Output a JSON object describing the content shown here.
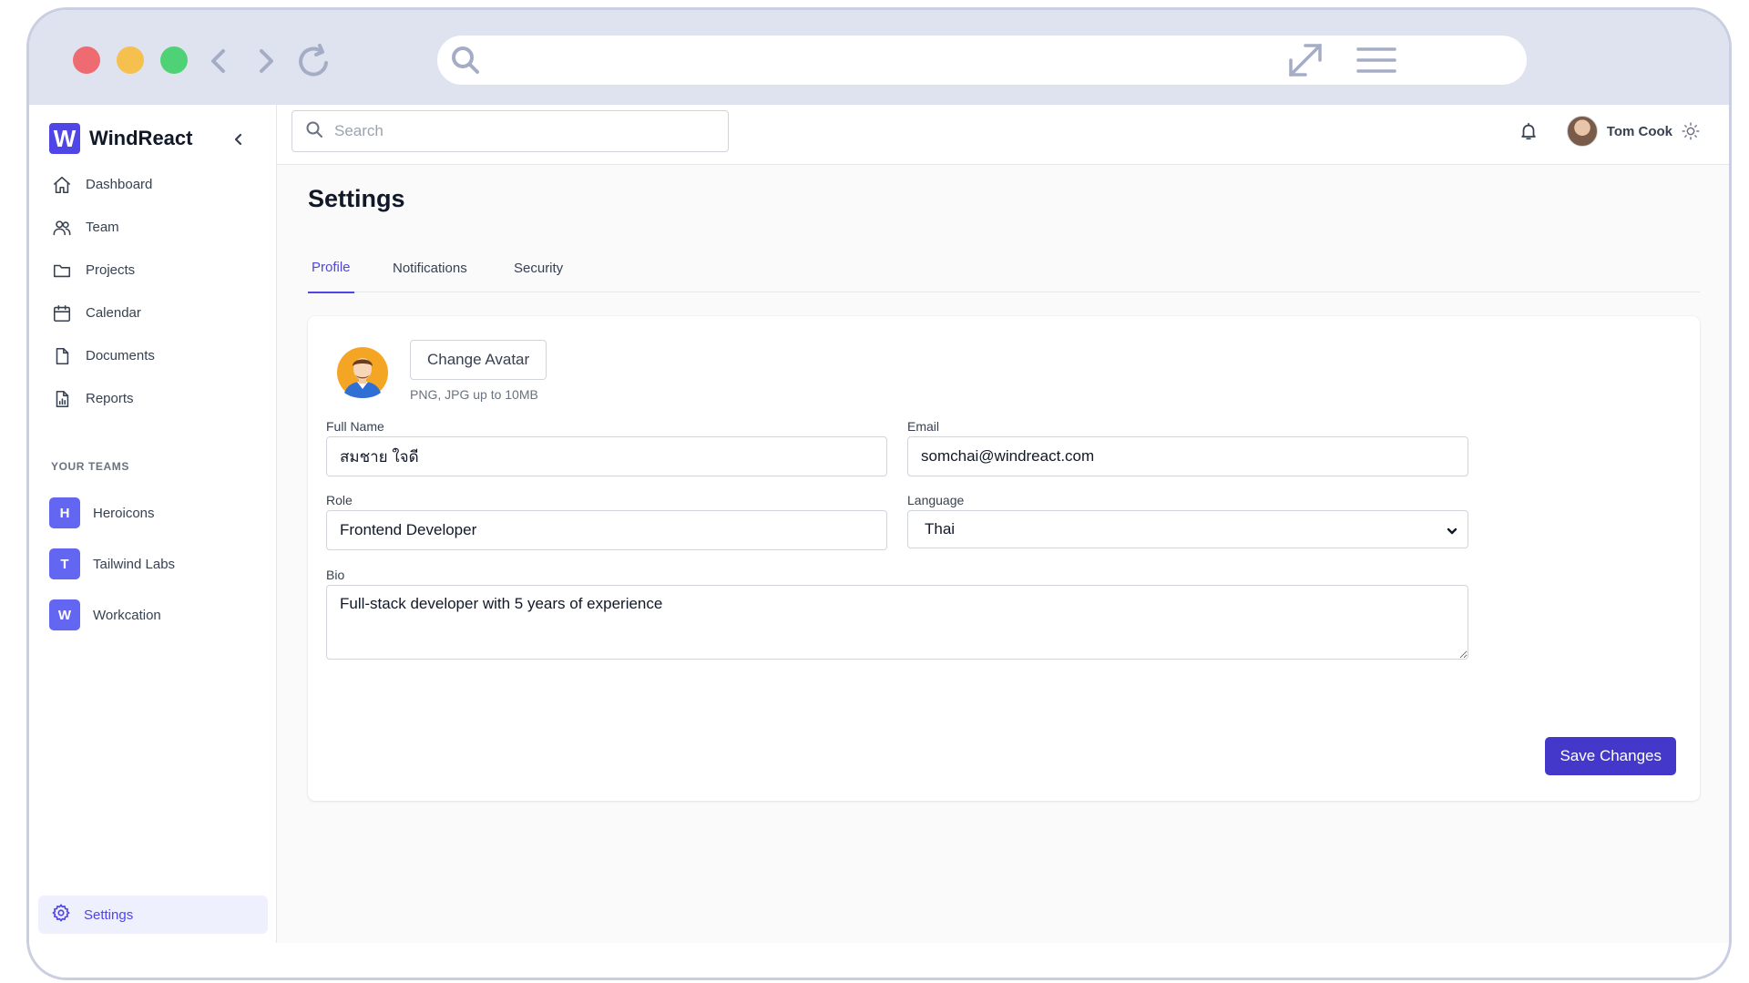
{
  "browser": {
    "url": ""
  },
  "brand": {
    "logo_letter": "W",
    "name": "WindReact"
  },
  "sidebar": {
    "items": [
      {
        "label": "Dashboard",
        "icon": "home-icon"
      },
      {
        "label": "Team",
        "icon": "users-icon"
      },
      {
        "label": "Projects",
        "icon": "folder-icon"
      },
      {
        "label": "Calendar",
        "icon": "calendar-icon"
      },
      {
        "label": "Documents",
        "icon": "document-icon"
      },
      {
        "label": "Reports",
        "icon": "chart-document-icon"
      }
    ],
    "teams_heading": "YOUR TEAMS",
    "teams": [
      {
        "initial": "H",
        "name": "Heroicons"
      },
      {
        "initial": "T",
        "name": "Tailwind Labs"
      },
      {
        "initial": "W",
        "name": "Workcation"
      }
    ],
    "settings_label": "Settings"
  },
  "topbar": {
    "search_placeholder": "Search",
    "user_name": "Tom Cook"
  },
  "page": {
    "title": "Settings",
    "tabs": [
      {
        "label": "Profile",
        "active": true
      },
      {
        "label": "Notifications",
        "active": false
      },
      {
        "label": "Security",
        "active": false
      }
    ]
  },
  "profile": {
    "change_avatar_label": "Change Avatar",
    "avatar_hint": "PNG, JPG up to 10MB",
    "full_name_label": "Full Name",
    "full_name_value": "สมชาย ใจดี",
    "email_label": "Email",
    "email_value": "somchai@windreact.com",
    "role_label": "Role",
    "role_value": "Frontend Developer",
    "language_label": "Language",
    "language_value": "Thai",
    "bio_label": "Bio",
    "bio_value": "Full-stack developer with 5 years of experience",
    "save_label": "Save Changes"
  },
  "colors": {
    "accent": "#4f46e5",
    "save_button": "#4338ca",
    "team_badge": "#6366f1"
  }
}
